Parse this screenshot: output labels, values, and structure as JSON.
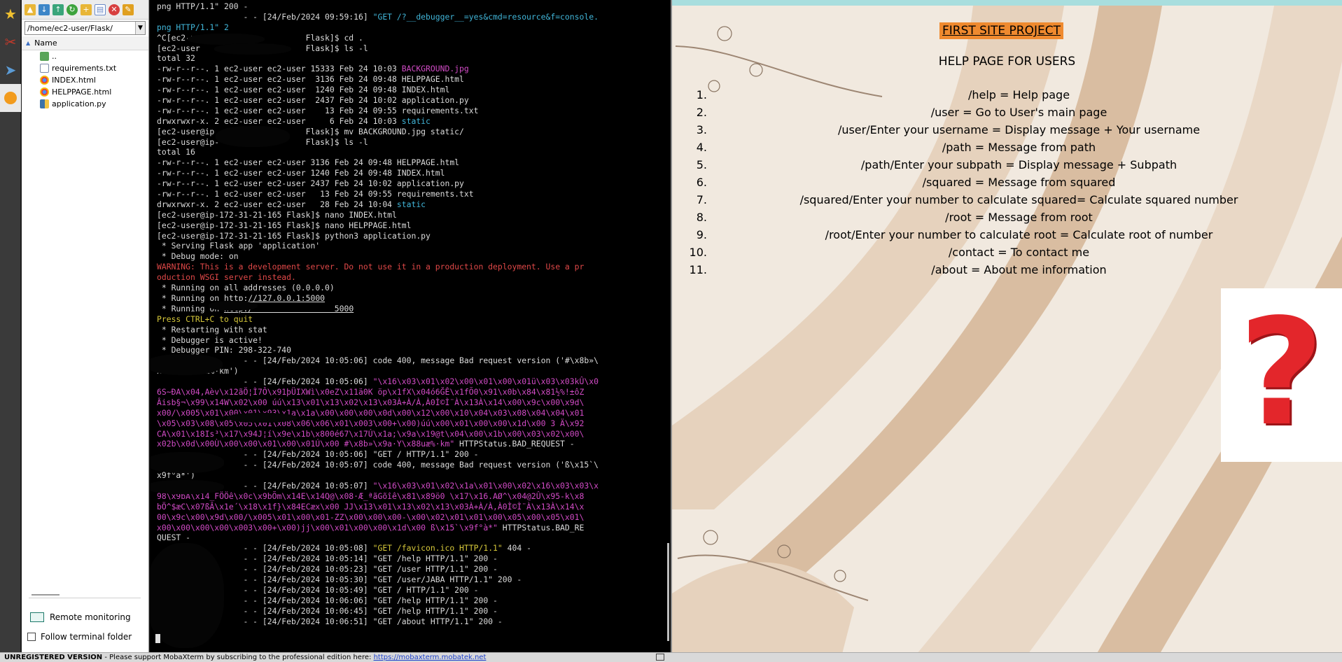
{
  "file_browser": {
    "path": "/home/ec2-user/Flask/",
    "column_name": "Name",
    "files": [
      {
        "name": "..",
        "type": "up"
      },
      {
        "name": "requirements.txt",
        "type": "txt"
      },
      {
        "name": "INDEX.html",
        "type": "html"
      },
      {
        "name": "HELPPAGE.html",
        "type": "html"
      },
      {
        "name": "application.py",
        "type": "py"
      }
    ],
    "remote_monitoring": "Remote monitoring",
    "follow_terminal": "Follow terminal folder"
  },
  "terminal": {
    "lines": [
      [
        {
          "t": "png HTTP/1.1\" 200 -"
        }
      ],
      [
        {
          "t": "                  - - [24/Feb/2024 09:59:16] "
        },
        {
          "t": "\"GET /?__debugger__=yes&cmd=resource&f=console.",
          "c": "c"
        }
      ],
      [
        {
          "t": "png HTTP/1.1\" 2",
          "c": "c"
        }
      ],
      [
        {
          "t": "^C[ec2-user@ip                 Flask]$ cd ."
        }
      ],
      [
        {
          "t": "[ec2-user                      Flask]$ ls -l"
        }
      ],
      [
        {
          "t": "total 32"
        }
      ],
      [
        {
          "t": "-rw-r--r--. 1 ec2-user ec2-user 15333 Feb 24 10:03 "
        },
        {
          "t": "BACKGROUND.jpg",
          "c": "m"
        }
      ],
      [
        {
          "t": "-rw-r--r--. 1 ec2-user ec2-user  3136 Feb 24 09:48 HELPPAGE.html"
        }
      ],
      [
        {
          "t": "-rw-r--r--. 1 ec2-user ec2-user  1240 Feb 24 09:48 INDEX.html"
        }
      ],
      [
        {
          "t": "-rw-r--r--. 1 ec2-user ec2-user  2437 Feb 24 10:02 application.py"
        }
      ],
      [
        {
          "t": "-rw-r--r--. 1 ec2-user ec2-user    13 Feb 24 09:55 requirements.txt"
        }
      ],
      [
        {
          "t": "drwxrwxr-x. 2 ec2-user ec2-user     6 Feb 24 10:03 "
        },
        {
          "t": "static",
          "c": "c"
        }
      ],
      [
        {
          "t": "[ec2-user@ip                   Flask]$ mv BACKGROUND.jpg static/"
        }
      ],
      [
        {
          "t": "[ec2-user@ip-                  Flask]$ ls -l"
        }
      ],
      [
        {
          "t": "total 16"
        }
      ],
      [
        {
          "t": "-rw-r--r--. 1 ec2-user ec2-user 3136 Feb 24 09:48 HELPPAGE.html"
        }
      ],
      [
        {
          "t": "-rw-r--r--. 1 ec2-user ec2-user 1240 Feb 24 09:48 INDEX.html"
        }
      ],
      [
        {
          "t": "-rw-r--r--. 1 ec2-user ec2-user 2437 Feb 24 10:02 application.py"
        }
      ],
      [
        {
          "t": "-rw-r--r--. 1 ec2-user ec2-user   13 Feb 24 09:55 requirements.txt"
        }
      ],
      [
        {
          "t": "drwxrwxr-x. 2 ec2-user ec2-user   28 Feb 24 10:04 "
        },
        {
          "t": "static",
          "c": "c"
        }
      ],
      [
        {
          "t": "[ec2-user@ip-172-31-21-165 Flask]$ nano INDEX.html"
        }
      ],
      [
        {
          "t": "[ec2-user@ip-172-31-21-165 Flask]$ nano HELPPAGE.html"
        }
      ],
      [
        {
          "t": "[ec2-user@ip-172-31-21-165 Flask]$ python3 application.py"
        }
      ],
      [
        {
          "t": " * Serving Flask app 'application'"
        }
      ],
      [
        {
          "t": " * Debug mode: on"
        }
      ],
      [
        {
          "t": "WARNING: This is a development server. Do not use it in a production deployment. Use a pr",
          "c": "r"
        }
      ],
      [
        {
          "t": "oduction WSGI server instead.",
          "c": "r"
        }
      ],
      [
        {
          "t": " * Running on all addresses (0.0.0.0)"
        }
      ],
      [
        {
          "t": " * Running on "
        },
        {
          "t": "http://127.0.0.1:5000",
          "c": "u"
        }
      ],
      [
        {
          "t": " * Running on "
        },
        {
          "t": "http:/                 5000",
          "c": "u"
        }
      ],
      [
        {
          "t": "Press CTRL+C to quit",
          "c": "y"
        }
      ],
      [
        {
          "t": " * Restarting with stat"
        }
      ],
      [
        {
          "t": " * Debugger is active!"
        }
      ],
      [
        {
          "t": " * Debugger PIN: 298-322-740"
        }
      ],
      [
        {
          "t": "                  - - [24/Feb/2024 10:05:06] code 400, message Bad request version ('#\\x8b»\\"
        }
      ],
      [
        {
          "t": "x9a·Y\\x88uæ%·km')"
        }
      ],
      [
        {
          "t": "                  - - [24/Feb/2024 10:05:06] "
        },
        {
          "t": "\"\\x16\\x03\\x01\\x02\\x00\\x01\\x00\\x01ü\\x03\\x03kÛ\\x0",
          "c": "m"
        }
      ],
      [
        {
          "t": "6S~ÐA\\x04,Aèv\\x12ãÖ¦Ì7Ô\\x91þÜIXWì\\x0eZ\\x11ä0K öp\\x1fX\\x04ó6ĞÊ\\x1fÕ0\\x91\\x0b\\x84\\x81½%!±ôZ",
          "c": "m"
        }
      ],
      [
        {
          "t": "Âisb§¬\\x99\\x14W\\x02\\x00 úú\\x13\\x01\\x13\\x02\\x13\\x03À+À/À,À0Ì©Ì¨À\\x13À\\x14\\x00\\x9c\\x00\\x9d\\",
          "c": "m"
        }
      ],
      [
        {
          "t": "x00/\\x005\\x01\\x00\\x01\\x93\\x1a\\x1a\\x00\\x00\\x00\\x0d\\x00\\x12\\x00\\x10\\x04\\x03\\x08\\x04\\x04\\x01",
          "c": "m"
        }
      ],
      [
        {
          "t": "\\x05\\x03\\x08\\x05\\x05\\x01\\x08\\x06\\x06\\x01\\x003\\x00+\\x00)úú\\x00\\x01\\x00\\x00\\x1d\\x00 3 Ä\\x92",
          "c": "m"
        }
      ],
      [
        {
          "t": "CA\\x01\\x18Is³\\x17\\x94J¦í\\x9e\\x1b\\x800é67\\x17Ú\\x1a;\\x9a\\x19@t\\x04\\x00\\x1b\\x00\\x03\\x02\\x00\\",
          "c": "m"
        }
      ],
      [
        {
          "t": "x02b\\x0d\\x00Ù\\x00\\x00\\x01\\x00\\x01Ú\\x00 #\\x8b»\\x9a·Y\\x88uæ%·km\"",
          "c": "m"
        },
        {
          "t": " HTTPStatus.BAD_REQUEST -"
        }
      ],
      [
        {
          "t": "                  - - [24/Feb/2024 10:05:06] \"GET / HTTP/1.1\" 200 -"
        }
      ],
      [
        {
          "t": "                  - - [24/Feb/2024 10:05:07] code 400, message Bad request version ('ß\\x15`\\"
        }
      ],
      [
        {
          "t": "x9f°à*')"
        }
      ],
      [
        {
          "t": "                  - - [24/Feb/2024 10:05:07] "
        },
        {
          "t": "\"\\x16\\x03\\x01\\x02\\x1a\\x01\\x00\\x02\\x16\\x03\\x03\\x",
          "c": "m"
        }
      ],
      [
        {
          "t": "98\\x9bÂ\\x14_FÖÖê\\x0c\\x9bÕm\\x14E\\x14Q@\\x08·Æ_ªãGõîê\\x81\\x89ö0 \\x17\\x16.AØ^\\x04@2Û\\x95-k\\x8",
          "c": "m"
        }
      ],
      [
        {
          "t": "bÖ^$æC\\x07ßÂ\\x1e´\\x18\\x1f}\\x84ECæx\\x00 JJ\\x13\\x01\\x13\\x02\\x13\\x03À+À/À,À0Ì©Ì¨À\\x13À\\x14\\x",
          "c": "m"
        }
      ],
      [
        {
          "t": "00\\x9c\\x00\\x9d\\x00/\\x005\\x01\\x00\\x01-ZZ\\x00\\x00\\x00-\\x00\\x02\\x01\\x01\\x00\\x05\\x00\\x05\\x01\\",
          "c": "m"
        }
      ],
      [
        {
          "t": "x00\\x00\\x00\\x00\\x003\\x00+\\x00)jj\\x00\\x01\\x00\\x00\\x1d\\x00 ß\\x15`\\x9f°à*\"",
          "c": "m"
        },
        {
          "t": " HTTPStatus.BAD_RE"
        }
      ],
      [
        {
          "t": "QUEST -"
        }
      ],
      [
        {
          "t": "                  - - [24/Feb/2024 10:05:08] "
        },
        {
          "t": "\"GET /favicon.ico HTTP/1.1\"",
          "c": "y"
        },
        {
          "t": " 404 -"
        }
      ],
      [
        {
          "t": "                  - - [24/Feb/2024 10:05:14] \"GET /help HTTP/1.1\" 200 -"
        }
      ],
      [
        {
          "t": "                  - - [24/Feb/2024 10:05:23] \"GET /user HTTP/1.1\" 200 -"
        }
      ],
      [
        {
          "t": "                  - - [24/Feb/2024 10:05:30] \"GET /user/JABA HTTP/1.1\" 200 -"
        }
      ],
      [
        {
          "t": "                  - - [24/Feb/2024 10:05:49] \"GET / HTTP/1.1\" 200 -"
        }
      ],
      [
        {
          "t": "                  - - [24/Feb/2024 10:06:06] \"GET /help HTTP/1.1\" 200 -"
        }
      ],
      [
        {
          "t": "                  - - [24/Feb/2024 10:06:45] \"GET /help HTTP/1.1\" 200 -"
        }
      ],
      [
        {
          "t": "                  - - [24/Feb/2024 10:06:51] \"GET /about HTTP/1.1\" 200 -"
        }
      ]
    ]
  },
  "webpage": {
    "title": "FIRST SITE PROJECT",
    "subtitle": "HELP PAGE FOR USERS",
    "items": [
      {
        "num": "1.",
        "text": "/help = Help page"
      },
      {
        "num": "2.",
        "text": "/user = Go to User's main page"
      },
      {
        "num": "3.",
        "text": "/user/Enter your username = Display message + Your username"
      },
      {
        "num": "4.",
        "text": "/path = Message from path"
      },
      {
        "num": "5.",
        "text": "/path/Enter your subpath = Display message + Subpath"
      },
      {
        "num": "6.",
        "text": "/squared = Message from squared"
      },
      {
        "num": "7.",
        "text": "/squared/Enter your number to calculate squared= Calculate squared number"
      },
      {
        "num": "8.",
        "text": "/root = Message from root"
      },
      {
        "num": "9.",
        "text": "/root/Enter your number to calculate root = Calculate root of number"
      },
      {
        "num": "10.",
        "text": "/contact = To contact me"
      },
      {
        "num": "11.",
        "text": "/about = About me information"
      }
    ],
    "question_mark": "?"
  },
  "status_bar": {
    "unregistered": "UNREGISTERED VERSION",
    "message": " -  Please support MobaXterm by subscribing to the professional edition here: ",
    "link": "https://mobaxterm.mobatek.net"
  },
  "colors": {
    "title_highlight": "#ef8a2f",
    "terminal_magenta": "#d24bc6",
    "terminal_cyan": "#41b5d8",
    "terminal_red": "#e04848",
    "terminal_yellow": "#d6c83a",
    "question_mark": "#e3262b"
  }
}
